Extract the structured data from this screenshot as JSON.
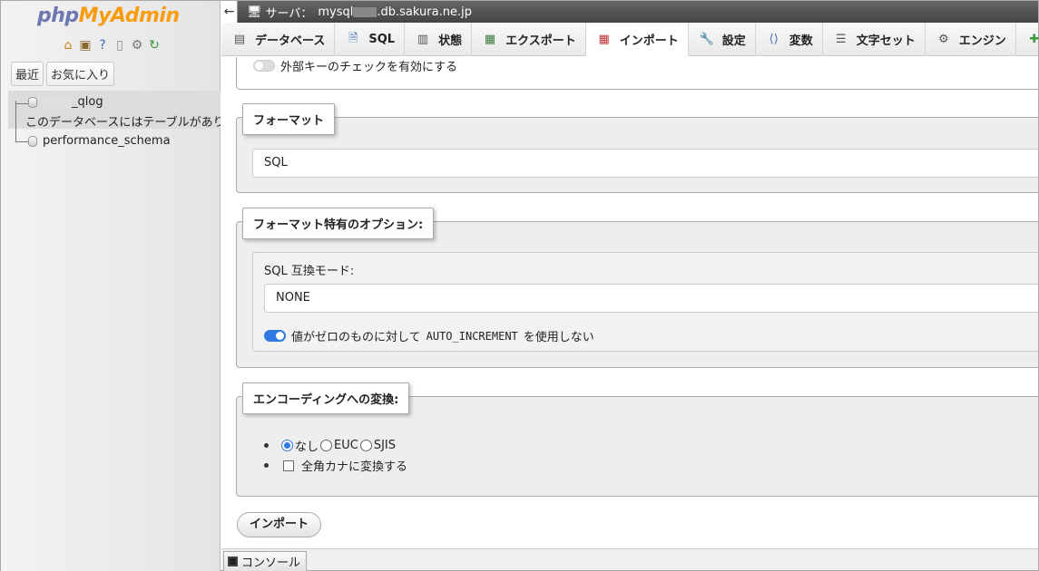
{
  "nav": {
    "logo_php": "php",
    "logo_myadmin": "MyAdmin",
    "icons": [
      "home-icon",
      "logout-icon",
      "help-icon",
      "docs-icon",
      "settings-icon",
      "reload-icon"
    ],
    "tabs": {
      "recent": "最近",
      "favorites": "お気に入り"
    },
    "databases": [
      {
        "name": "_qlog",
        "note": "このデータベースにはテーブルがありません。"
      },
      {
        "name": "performance_schema"
      }
    ]
  },
  "topbar": {
    "back_glyph": "←",
    "server_label": "サーバ：",
    "server_host": "mysql",
    "server_host_suffix": ".db.sakura.ne.jp"
  },
  "menu": {
    "tabs": [
      {
        "label": "データベース",
        "icon": "database-icon"
      },
      {
        "label": "SQL",
        "icon": "sql-icon"
      },
      {
        "label": "状態",
        "icon": "status-icon"
      },
      {
        "label": "エクスポート",
        "icon": "export-icon"
      },
      {
        "label": "インポート",
        "icon": "import-icon",
        "active": true
      },
      {
        "label": "設定",
        "icon": "wrench-icon"
      },
      {
        "label": "変数",
        "icon": "variables-icon"
      },
      {
        "label": "文字セット",
        "icon": "charset-icon"
      },
      {
        "label": "エンジン",
        "icon": "engine-icon"
      }
    ]
  },
  "import": {
    "fk_check_label": "外部キーのチェックを有効にする",
    "fk_check_enabled": false,
    "format_legend": "フォーマット",
    "format_value": "SQL",
    "format_options_legend": "フォーマット特有のオプション:",
    "sql_compat_label": "SQL 互換モード:",
    "sql_compat_value": "NONE",
    "autoinc_prefix": "値がゼロのものに対して",
    "autoinc_code": "AUTO_INCREMENT",
    "autoinc_suffix": "を使用しない",
    "autoinc_enabled": true,
    "encoding_legend": "エンコーディングへの変換:",
    "encoding_options": [
      "なし",
      "EUC",
      "SJIS"
    ],
    "encoding_selected": "なし",
    "kana_label": "全角カナに変換する",
    "kana_checked": false,
    "import_button": "インポート"
  },
  "console": {
    "label": "コンソール"
  },
  "colors": {
    "accent": "#2f7ae5",
    "logo_php": "#6c78af",
    "logo_myadmin": "#f89c0e"
  }
}
